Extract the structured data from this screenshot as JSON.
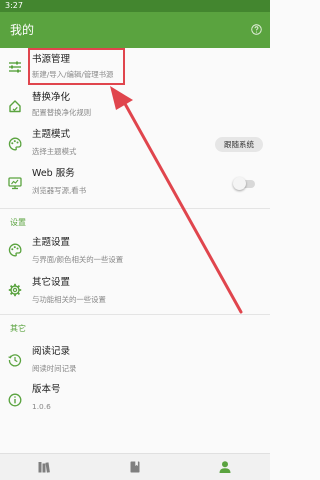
{
  "status_bar": {
    "time": "3:27"
  },
  "app_bar": {
    "title": "我的"
  },
  "colors": {
    "primary": "#5aa33f",
    "status_bar": "#43862f",
    "annotation": "#e0454d"
  },
  "items": {
    "book_source": {
      "title": "书源管理",
      "subtitle": "新建/导入/编辑/管理书源"
    },
    "replace": {
      "title": "替换净化",
      "subtitle": "配置替换净化规则"
    },
    "theme_mode": {
      "title": "主题模式",
      "subtitle": "选择主题模式",
      "chip": "跟随系统"
    },
    "web_service": {
      "title": "Web 服务",
      "subtitle": "浏览器写源,看书",
      "enabled": false
    }
  },
  "settings": {
    "label": "设置",
    "theme_settings": {
      "title": "主题设置",
      "subtitle": "与界面/颜色相关的一些设置"
    },
    "other_settings": {
      "title": "其它设置",
      "subtitle": "与功能相关的一些设置"
    }
  },
  "other": {
    "label": "其它",
    "read_record": {
      "title": "阅读记录",
      "subtitle": "阅读时间记录"
    },
    "version": {
      "title": "版本号",
      "subtitle": "1.0.6"
    }
  },
  "icons": {
    "help": "help-circle-icon",
    "book_source": "sliders-icon",
    "replace": "home-clean-icon",
    "theme_mode": "palette-icon",
    "web_service": "monitor-icon",
    "theme_settings": "palette-icon",
    "other_settings": "gear-icon",
    "read_record": "history-icon",
    "version": "info-icon",
    "nav_bookshelf": "bookshelf-icon",
    "nav_explore": "book-icon",
    "nav_my": "person-icon"
  },
  "bottom_nav": {
    "active_index": 2
  }
}
